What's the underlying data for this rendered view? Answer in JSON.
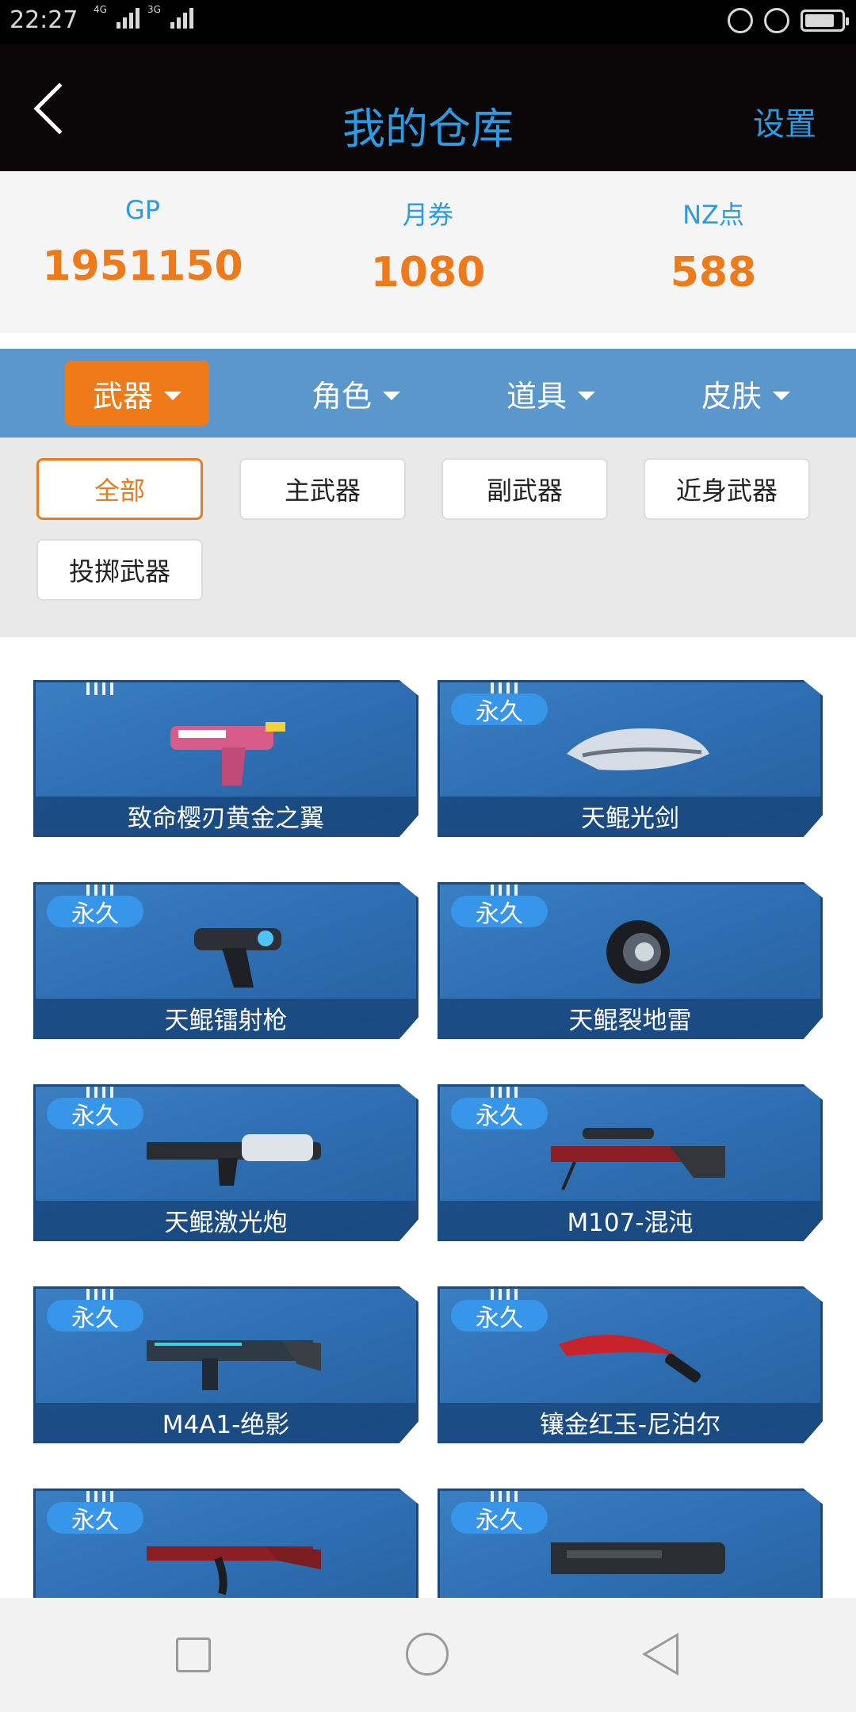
{
  "status": {
    "time": "22:27",
    "net1": "4G",
    "net2": "3G"
  },
  "header": {
    "title": "我的仓库",
    "settings_label": "设置"
  },
  "currency": [
    {
      "label": "GP",
      "value": "1951150"
    },
    {
      "label": "月券",
      "value": "1080"
    },
    {
      "label": "NZ点",
      "value": "588"
    }
  ],
  "categories": [
    "武器",
    "角色",
    "道具",
    "皮肤"
  ],
  "filters": [
    "全部",
    "主武器",
    "副武器",
    "近身武器",
    "投掷武器"
  ],
  "items": [
    {
      "name": "致命樱刃黄金之翼",
      "badge": ""
    },
    {
      "name": "天鲲光剑",
      "badge": "永久"
    },
    {
      "name": "天鲲镭射枪",
      "badge": "永久"
    },
    {
      "name": "天鲲裂地雷",
      "badge": "永久"
    },
    {
      "name": "天鲲激光炮",
      "badge": "永久"
    },
    {
      "name": "M107-混沌",
      "badge": "永久"
    },
    {
      "name": "M4A1-绝影",
      "badge": "永久"
    },
    {
      "name": "镶金红玉-尼泊尔",
      "badge": "永久"
    },
    {
      "name": "",
      "badge": "永久"
    },
    {
      "name": "",
      "badge": "永久"
    }
  ],
  "colors": {
    "accent_orange": "#ef7a1a",
    "accent_blue": "#2b9be6",
    "category_bar": "#5b97cc"
  }
}
